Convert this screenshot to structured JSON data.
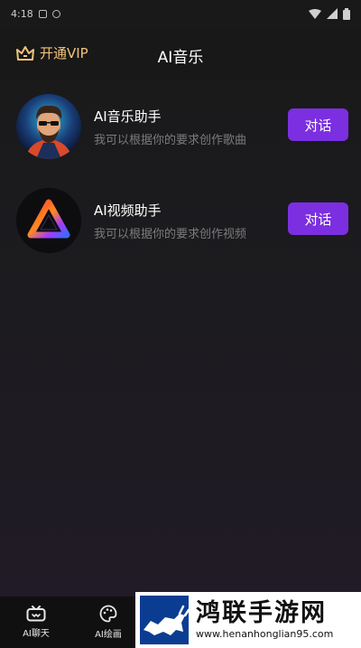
{
  "status_bar": {
    "time": "4:18"
  },
  "header": {
    "vip_label": "开通VIP",
    "title": "AI音乐"
  },
  "assistants": [
    {
      "title": "AI音乐助手",
      "description": "我可以根据你的要求创作歌曲",
      "button_label": "对话",
      "avatar_icon": "bearded-man-portrait"
    },
    {
      "title": "AI视频助手",
      "description": "我可以根据你的要求创作视频",
      "button_label": "对话",
      "avatar_icon": "gradient-triangle-logo"
    }
  ],
  "tabs": [
    {
      "label": "AI聊天",
      "icon": "tv-icon"
    },
    {
      "label": "AI绘画",
      "icon": "palette-icon"
    }
  ],
  "watermark": {
    "brand": "鸿联手游网",
    "url": "www.henanhonglian95.com"
  },
  "colors": {
    "accent": "#7b2fe0",
    "vip_gold": "#f1c47a",
    "background": "#1b1a1e"
  }
}
